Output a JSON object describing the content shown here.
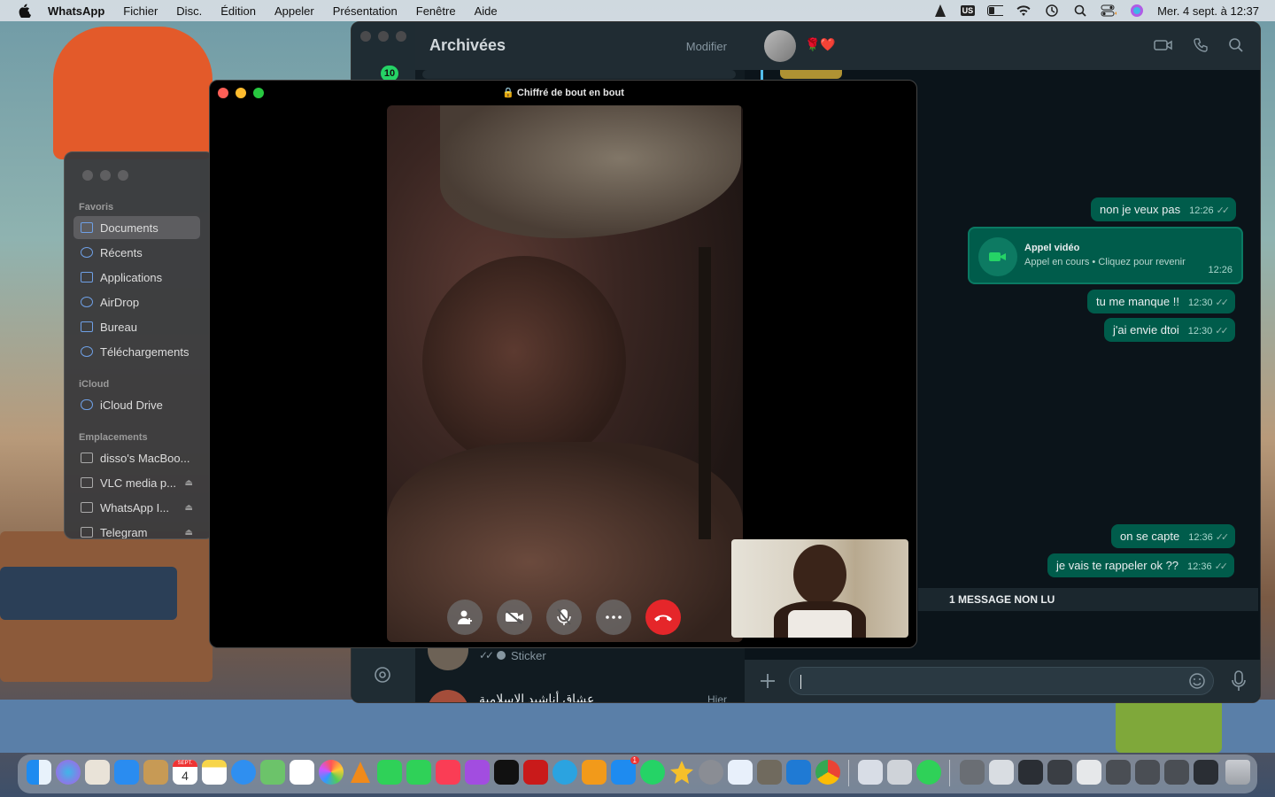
{
  "menubar": {
    "app_name": "WhatsApp",
    "menus": [
      "Fichier",
      "Disc.",
      "Édition",
      "Appeler",
      "Présentation",
      "Fenêtre",
      "Aide"
    ],
    "keyboard_layout": "US",
    "datetime": "Mer. 4 sept. à  12:37"
  },
  "finder": {
    "sections": {
      "favorites": "Favoris",
      "icloud": "iCloud",
      "locations": "Emplacements"
    },
    "favorites": [
      "Documents",
      "Récents",
      "Applications",
      "AirDrop",
      "Bureau",
      "Téléchargements"
    ],
    "icloud_items": [
      "iCloud Drive"
    ],
    "locations": [
      "disso's MacBoo...",
      "VLC media p...",
      "WhatsApp I...",
      "Telegram"
    ],
    "selected": "Documents"
  },
  "whatsapp": {
    "left_title": "Archivées",
    "edit_label": "Modifier",
    "badge_count": "10",
    "contact_emoji": "🌹❤️",
    "list_preview": {
      "sticker_label": "Sticker",
      "arabic_name": "عشاق أناشيد الإسلامية",
      "date": "Hier"
    },
    "messages": [
      {
        "text": "non je veux pas",
        "time": "12:26"
      },
      {
        "text": "tu me manque !!",
        "time": "12:30"
      },
      {
        "text": "j'ai envie dtoi",
        "time": "12:30"
      },
      {
        "text": "on se capte",
        "time": "12:36"
      },
      {
        "text": "je vais te rappeler ok ??",
        "time": "12:36"
      }
    ],
    "call_card": {
      "title": "Appel vidéo",
      "subtitle": "Appel en cours • Cliquez pour revenir",
      "time": "12:26"
    },
    "unread_banner": "1 MESSAGE NON LU"
  },
  "call_window": {
    "title": "Chiffré de bout en bout"
  },
  "dock": {
    "calendar_month": "SEPT.",
    "calendar_day": "4",
    "appstore_badge": "1"
  },
  "colors": {
    "outgoing_bubble": "#005c4b",
    "end_call": "#e5262a",
    "wa_header": "#202c33",
    "wa_background": "#0b141a"
  }
}
